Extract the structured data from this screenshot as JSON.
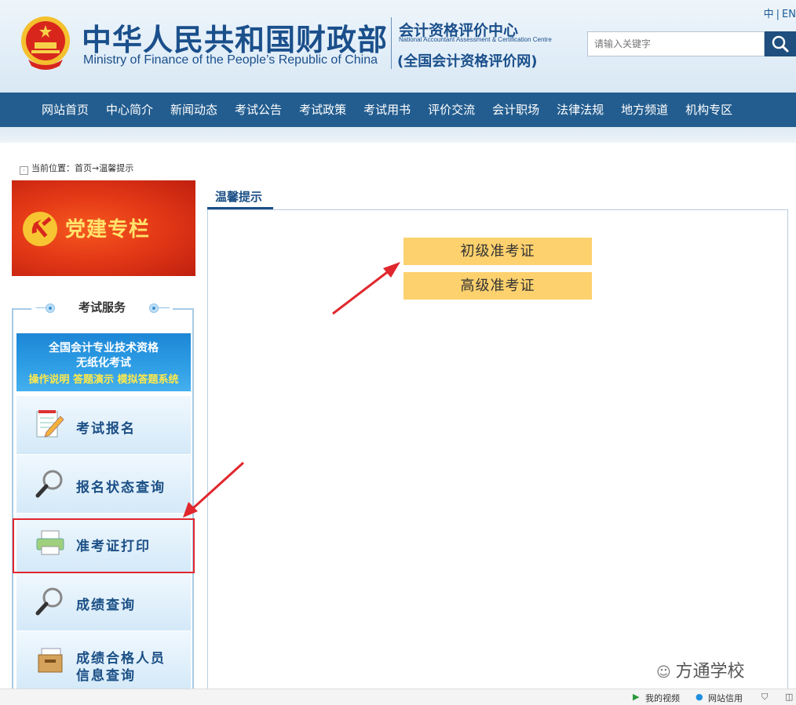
{
  "header": {
    "title_cn": "中华人民共和国财政部",
    "title_en": "Ministry of Finance of the People’s Republic of China",
    "center_cn": "会计资格评价中心",
    "center_en": "National Accountant Assessment & Certification Centre",
    "center_net": "(全国会计资格评价网)",
    "lang_cn": "中",
    "lang_en": "EN",
    "search_placeholder": "请输入关键字"
  },
  "nav": [
    "网站首页",
    "中心简介",
    "新闻动态",
    "考试公告",
    "考试政策",
    "考试用书",
    "评价交流",
    "会计职场",
    "法律法规",
    "地方频道",
    "机构专区"
  ],
  "breadcrumb": "当前位置：首页→温馨提示",
  "party_banner": "党建专栏",
  "sidebar": {
    "title": "考试服务",
    "paper_banner": {
      "line1": "全国会计专业技术资格",
      "line2": "无纸化考试",
      "line3": "操作说明 答题演示 模拟答题系统"
    },
    "items": [
      {
        "label": "考试报名",
        "icon": "notepad-pencil-icon"
      },
      {
        "label": "报名状态查询",
        "icon": "magnifier-icon"
      },
      {
        "label": "准考证打印",
        "icon": "printer-icon"
      },
      {
        "label": "成绩查询",
        "icon": "magnifier-icon"
      },
      {
        "label": "成绩合格人员",
        "label2": "信息查询",
        "icon": "file-box-icon"
      }
    ]
  },
  "main": {
    "tab": "温馨提示",
    "buttons": [
      "初级准考证",
      "高级准考证"
    ]
  },
  "watermark": "方通学校",
  "statusbar": {
    "video": "我的视频",
    "credit": "网站信用"
  },
  "colors": {
    "nav_bg": "#235d8f",
    "brand_blue": "#1a4f8b",
    "cert_button": "#fdd16d",
    "highlight_red": "#e0272d"
  }
}
